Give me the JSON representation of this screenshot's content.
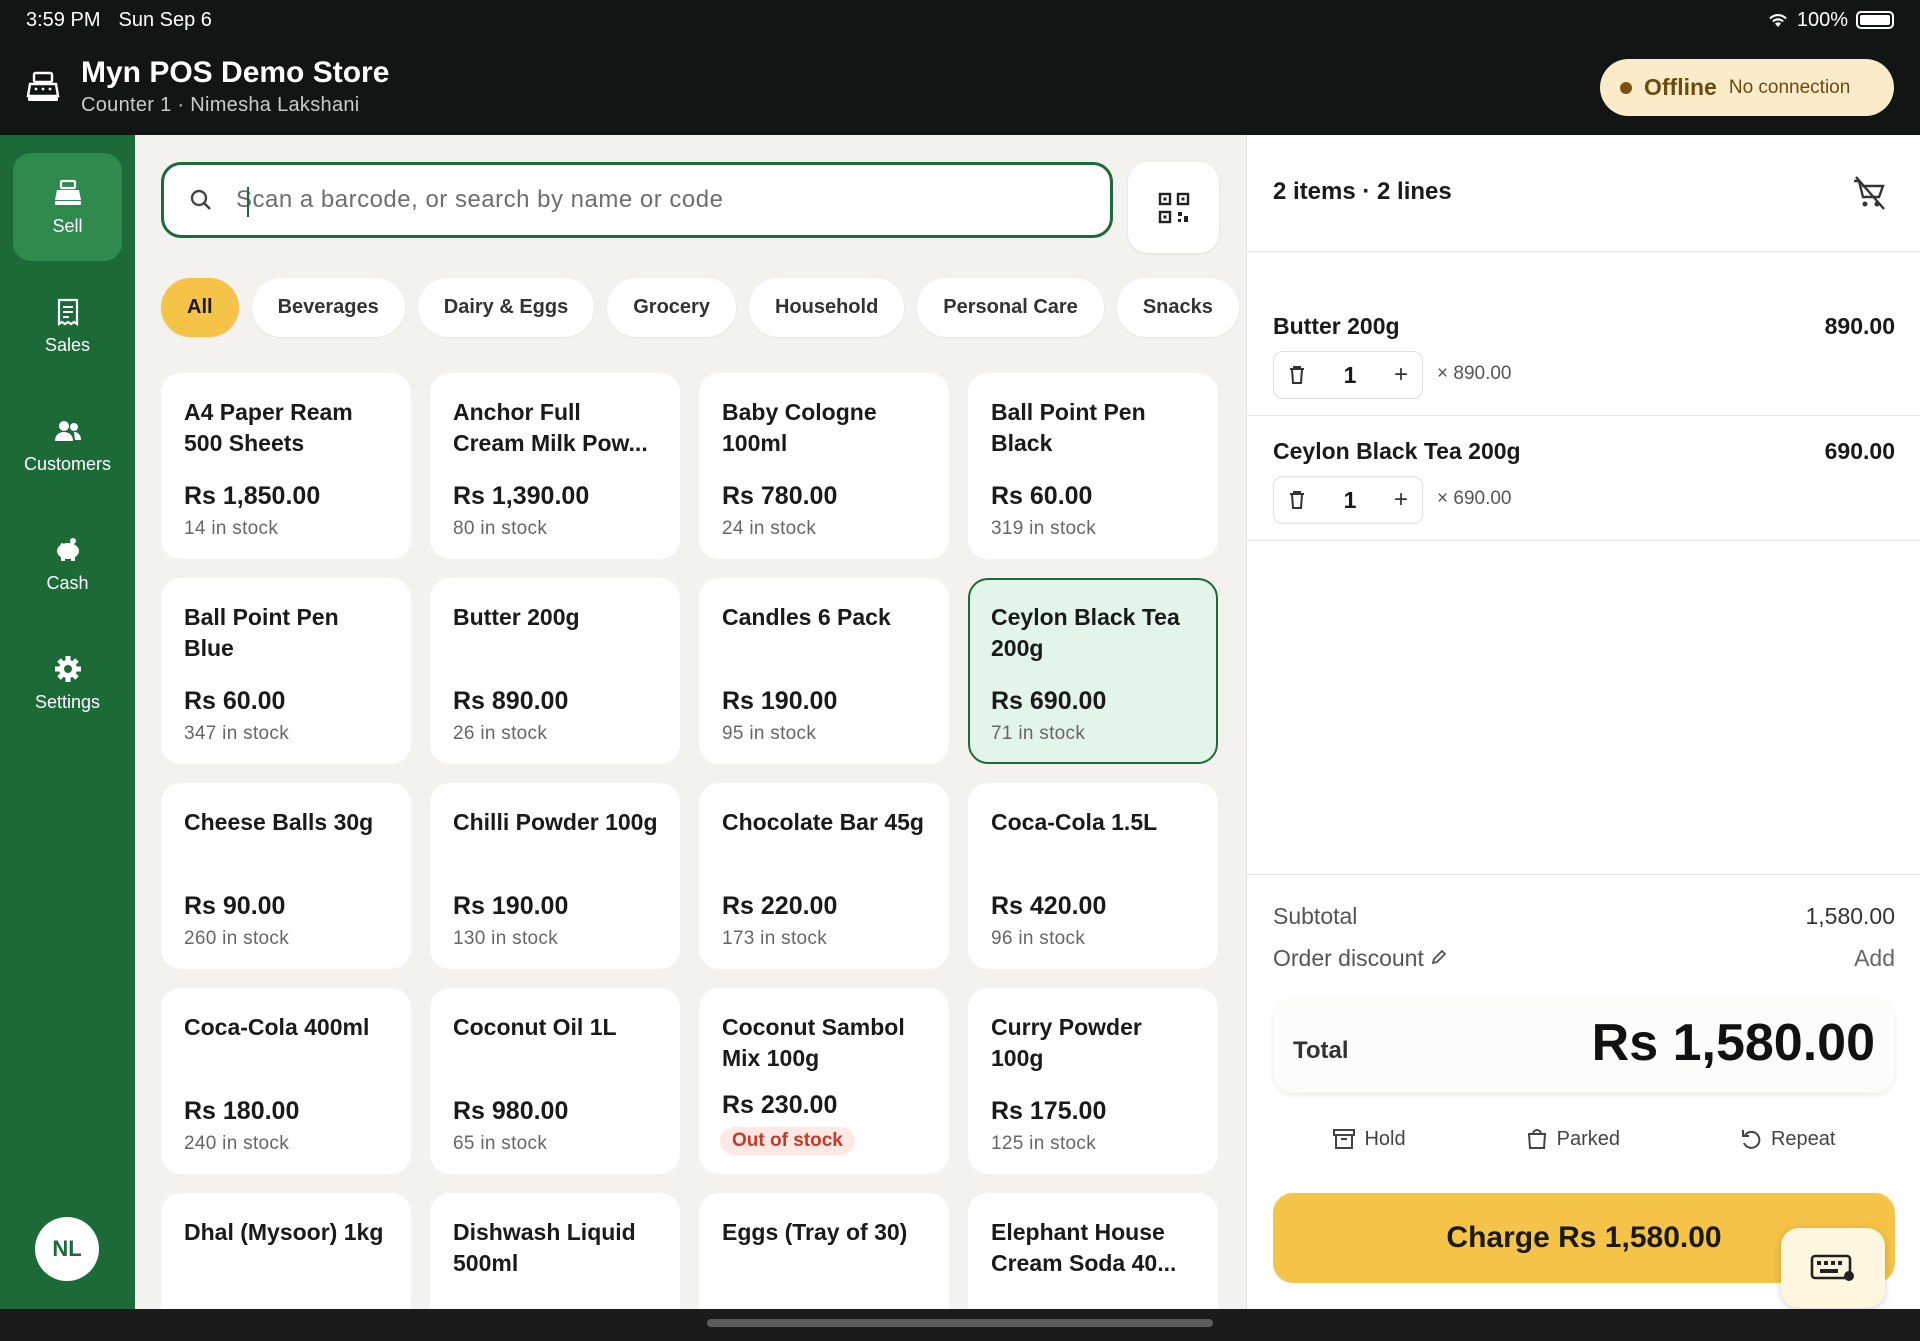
{
  "status_bar": {
    "time": "3:59 PM",
    "date": "Sun Sep 6",
    "battery": "100%"
  },
  "header": {
    "store_name": "Myn POS Demo Store",
    "subtitle": "Counter 1 · Nimesha Lakshani",
    "offline_label": "Offline",
    "offline_sub": "No connection"
  },
  "sidebar": {
    "items": [
      {
        "label": "Sell",
        "icon": "register-icon",
        "active": true
      },
      {
        "label": "Sales",
        "icon": "receipt-icon"
      },
      {
        "label": "Customers",
        "icon": "people-icon"
      },
      {
        "label": "Cash",
        "icon": "piggy-bank-icon"
      },
      {
        "label": "Settings",
        "icon": "gear-icon"
      }
    ],
    "avatar_initials": "NL"
  },
  "search": {
    "placeholder": "Scan a barcode, or search by name or code",
    "value": ""
  },
  "categories": [
    "All",
    "Beverages",
    "Dairy & Eggs",
    "Grocery",
    "Household",
    "Personal Care",
    "Snacks"
  ],
  "active_category": "All",
  "products": [
    {
      "name": "A4 Paper Ream 500 Sheets",
      "price": "Rs 1,850.00",
      "stock": "14 in stock"
    },
    {
      "name": "Anchor Full Cream Milk Pow...",
      "price": "Rs 1,390.00",
      "stock": "80 in stock"
    },
    {
      "name": "Baby Cologne 100ml",
      "price": "Rs 780.00",
      "stock": "24 in stock"
    },
    {
      "name": "Ball Point Pen Black",
      "price": "Rs 60.00",
      "stock": "319 in stock"
    },
    {
      "name": "Ball Point Pen Blue",
      "price": "Rs 60.00",
      "stock": "347 in stock"
    },
    {
      "name": "Butter 200g",
      "price": "Rs 890.00",
      "stock": "26 in stock"
    },
    {
      "name": "Candles 6 Pack",
      "price": "Rs 190.00",
      "stock": "95 in stock"
    },
    {
      "name": "Ceylon Black Tea 200g",
      "price": "Rs 690.00",
      "stock": "71 in stock",
      "selected": true
    },
    {
      "name": "Cheese Balls 30g",
      "price": "Rs 90.00",
      "stock": "260 in stock"
    },
    {
      "name": "Chilli Powder 100g",
      "price": "Rs 190.00",
      "stock": "130 in stock"
    },
    {
      "name": "Chocolate Bar 45g",
      "price": "Rs 220.00",
      "stock": "173 in stock"
    },
    {
      "name": "Coca-Cola 1.5L",
      "price": "Rs 420.00",
      "stock": "96 in stock"
    },
    {
      "name": "Coca-Cola 400ml",
      "price": "Rs 180.00",
      "stock": "240 in stock"
    },
    {
      "name": "Coconut Oil 1L",
      "price": "Rs 980.00",
      "stock": "65 in stock"
    },
    {
      "name": "Coconut Sambol Mix 100g",
      "price": "Rs 230.00",
      "stock": "Out of stock",
      "out_of_stock": true
    },
    {
      "name": "Curry Powder 100g",
      "price": "Rs 175.00",
      "stock": "125 in stock"
    },
    {
      "name": "Dhal (Mysoor) 1kg",
      "price": "",
      "stock": ""
    },
    {
      "name": "Dishwash Liquid 500ml",
      "price": "",
      "stock": ""
    },
    {
      "name": "Eggs (Tray of 30)",
      "price": "",
      "stock": ""
    },
    {
      "name": "Elephant House Cream Soda 40...",
      "price": "",
      "stock": ""
    }
  ],
  "cart": {
    "summary": "2 items · 2 lines",
    "lines": [
      {
        "name": "Butter 200g",
        "qty": "1",
        "unit": "× 890.00",
        "total": "890.00"
      },
      {
        "name": "Ceylon Black Tea 200g",
        "qty": "1",
        "unit": "× 690.00",
        "total": "690.00"
      }
    ],
    "subtotal_label": "Subtotal",
    "subtotal": "1,580.00",
    "discount_label": "Order discount",
    "discount_action": "Add",
    "total_label": "Total",
    "total": "Rs 1,580.00",
    "actions": {
      "hold": "Hold",
      "parked": "Parked",
      "repeat": "Repeat"
    },
    "charge_label": "Charge Rs 1,580.00"
  },
  "colors": {
    "brand_green": "#1c6a37",
    "accent_yellow": "#f4c347",
    "selected_bg": "#e3f5e8",
    "out_of_stock_red": "#c43b2a"
  }
}
